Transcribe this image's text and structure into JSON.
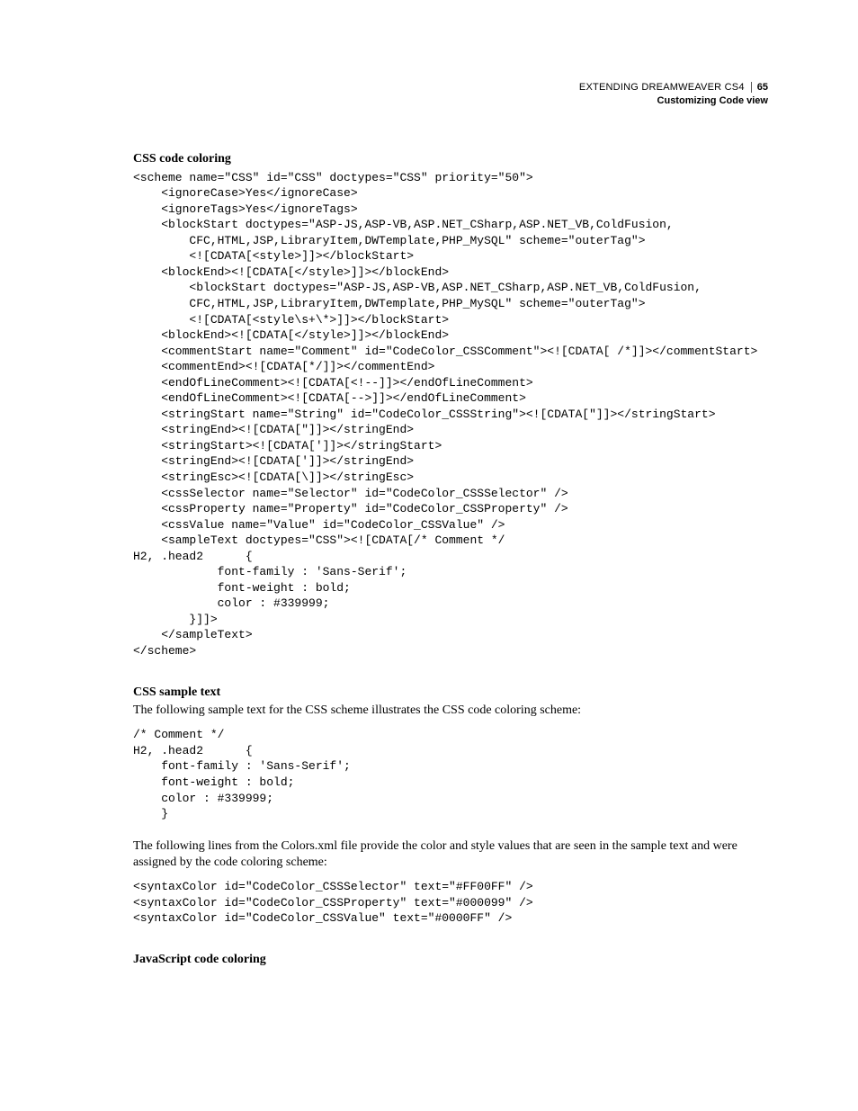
{
  "header": {
    "doc_title": "EXTENDING DREAMWEAVER CS4",
    "page_number": "65",
    "chapter": "Customizing Code view"
  },
  "sections": {
    "css_code_coloring": {
      "heading": "CSS code coloring",
      "code": "<scheme name=\"CSS\" id=\"CSS\" doctypes=\"CSS\" priority=\"50\">\n    <ignoreCase>Yes</ignoreCase>\n    <ignoreTags>Yes</ignoreTags>\n    <blockStart doctypes=\"ASP-JS,ASP-VB,ASP.NET_CSharp,ASP.NET_VB,ColdFusion,\n        CFC,HTML,JSP,LibraryItem,DWTemplate,PHP_MySQL\" scheme=\"outerTag\">\n        <![CDATA[<style>]]></blockStart>\n    <blockEnd><![CDATA[</style>]]></blockEnd>\n        <blockStart doctypes=\"ASP-JS,ASP-VB,ASP.NET_CSharp,ASP.NET_VB,ColdFusion,\n        CFC,HTML,JSP,LibraryItem,DWTemplate,PHP_MySQL\" scheme=\"outerTag\">\n        <![CDATA[<style\\s+\\*>]]></blockStart>\n    <blockEnd><![CDATA[</style>]]></blockEnd>\n    <commentStart name=\"Comment\" id=\"CodeColor_CSSComment\"><![CDATA[ /*]]></commentStart>\n    <commentEnd><![CDATA[*/]]></commentEnd>\n    <endOfLineComment><![CDATA[<!--]]></endOfLineComment>\n    <endOfLineComment><![CDATA[-->]]></endOfLineComment>\n    <stringStart name=\"String\" id=\"CodeColor_CSSString\"><![CDATA[\"]]></stringStart>\n    <stringEnd><![CDATA[\"]]></stringEnd>\n    <stringStart><![CDATA[']]></stringStart>\n    <stringEnd><![CDATA[']]></stringEnd>\n    <stringEsc><![CDATA[\\]]></stringEsc>\n    <cssSelector name=\"Selector\" id=\"CodeColor_CSSSelector\" />\n    <cssProperty name=\"Property\" id=\"CodeColor_CSSProperty\" />\n    <cssValue name=\"Value\" id=\"CodeColor_CSSValue\" />\n    <sampleText doctypes=\"CSS\"><![CDATA[/* Comment */\nH2, .head2      {\n            font-family : 'Sans-Serif';\n            font-weight : bold;\n            color : #339999;\n        }]]>\n    </sampleText>\n</scheme>"
    },
    "css_sample_text": {
      "heading": "CSS sample text",
      "para1": "The following sample text for the CSS scheme illustrates the CSS code coloring scheme:",
      "code1": "/* Comment */\nH2, .head2      {\n    font-family : 'Sans-Serif';\n    font-weight : bold;\n    color : #339999;\n    }",
      "para2": "The following lines from the Colors.xml file provide the color and style values that are seen in the sample text and were assigned by the code coloring scheme:",
      "code2": "<syntaxColor id=\"CodeColor_CSSSelector\" text=\"#FF00FF\" />\n<syntaxColor id=\"CodeColor_CSSProperty\" text=\"#000099\" />\n<syntaxColor id=\"CodeColor_CSSValue\" text=\"#0000FF\" />"
    },
    "js_code_coloring": {
      "heading": "JavaScript code coloring"
    }
  }
}
